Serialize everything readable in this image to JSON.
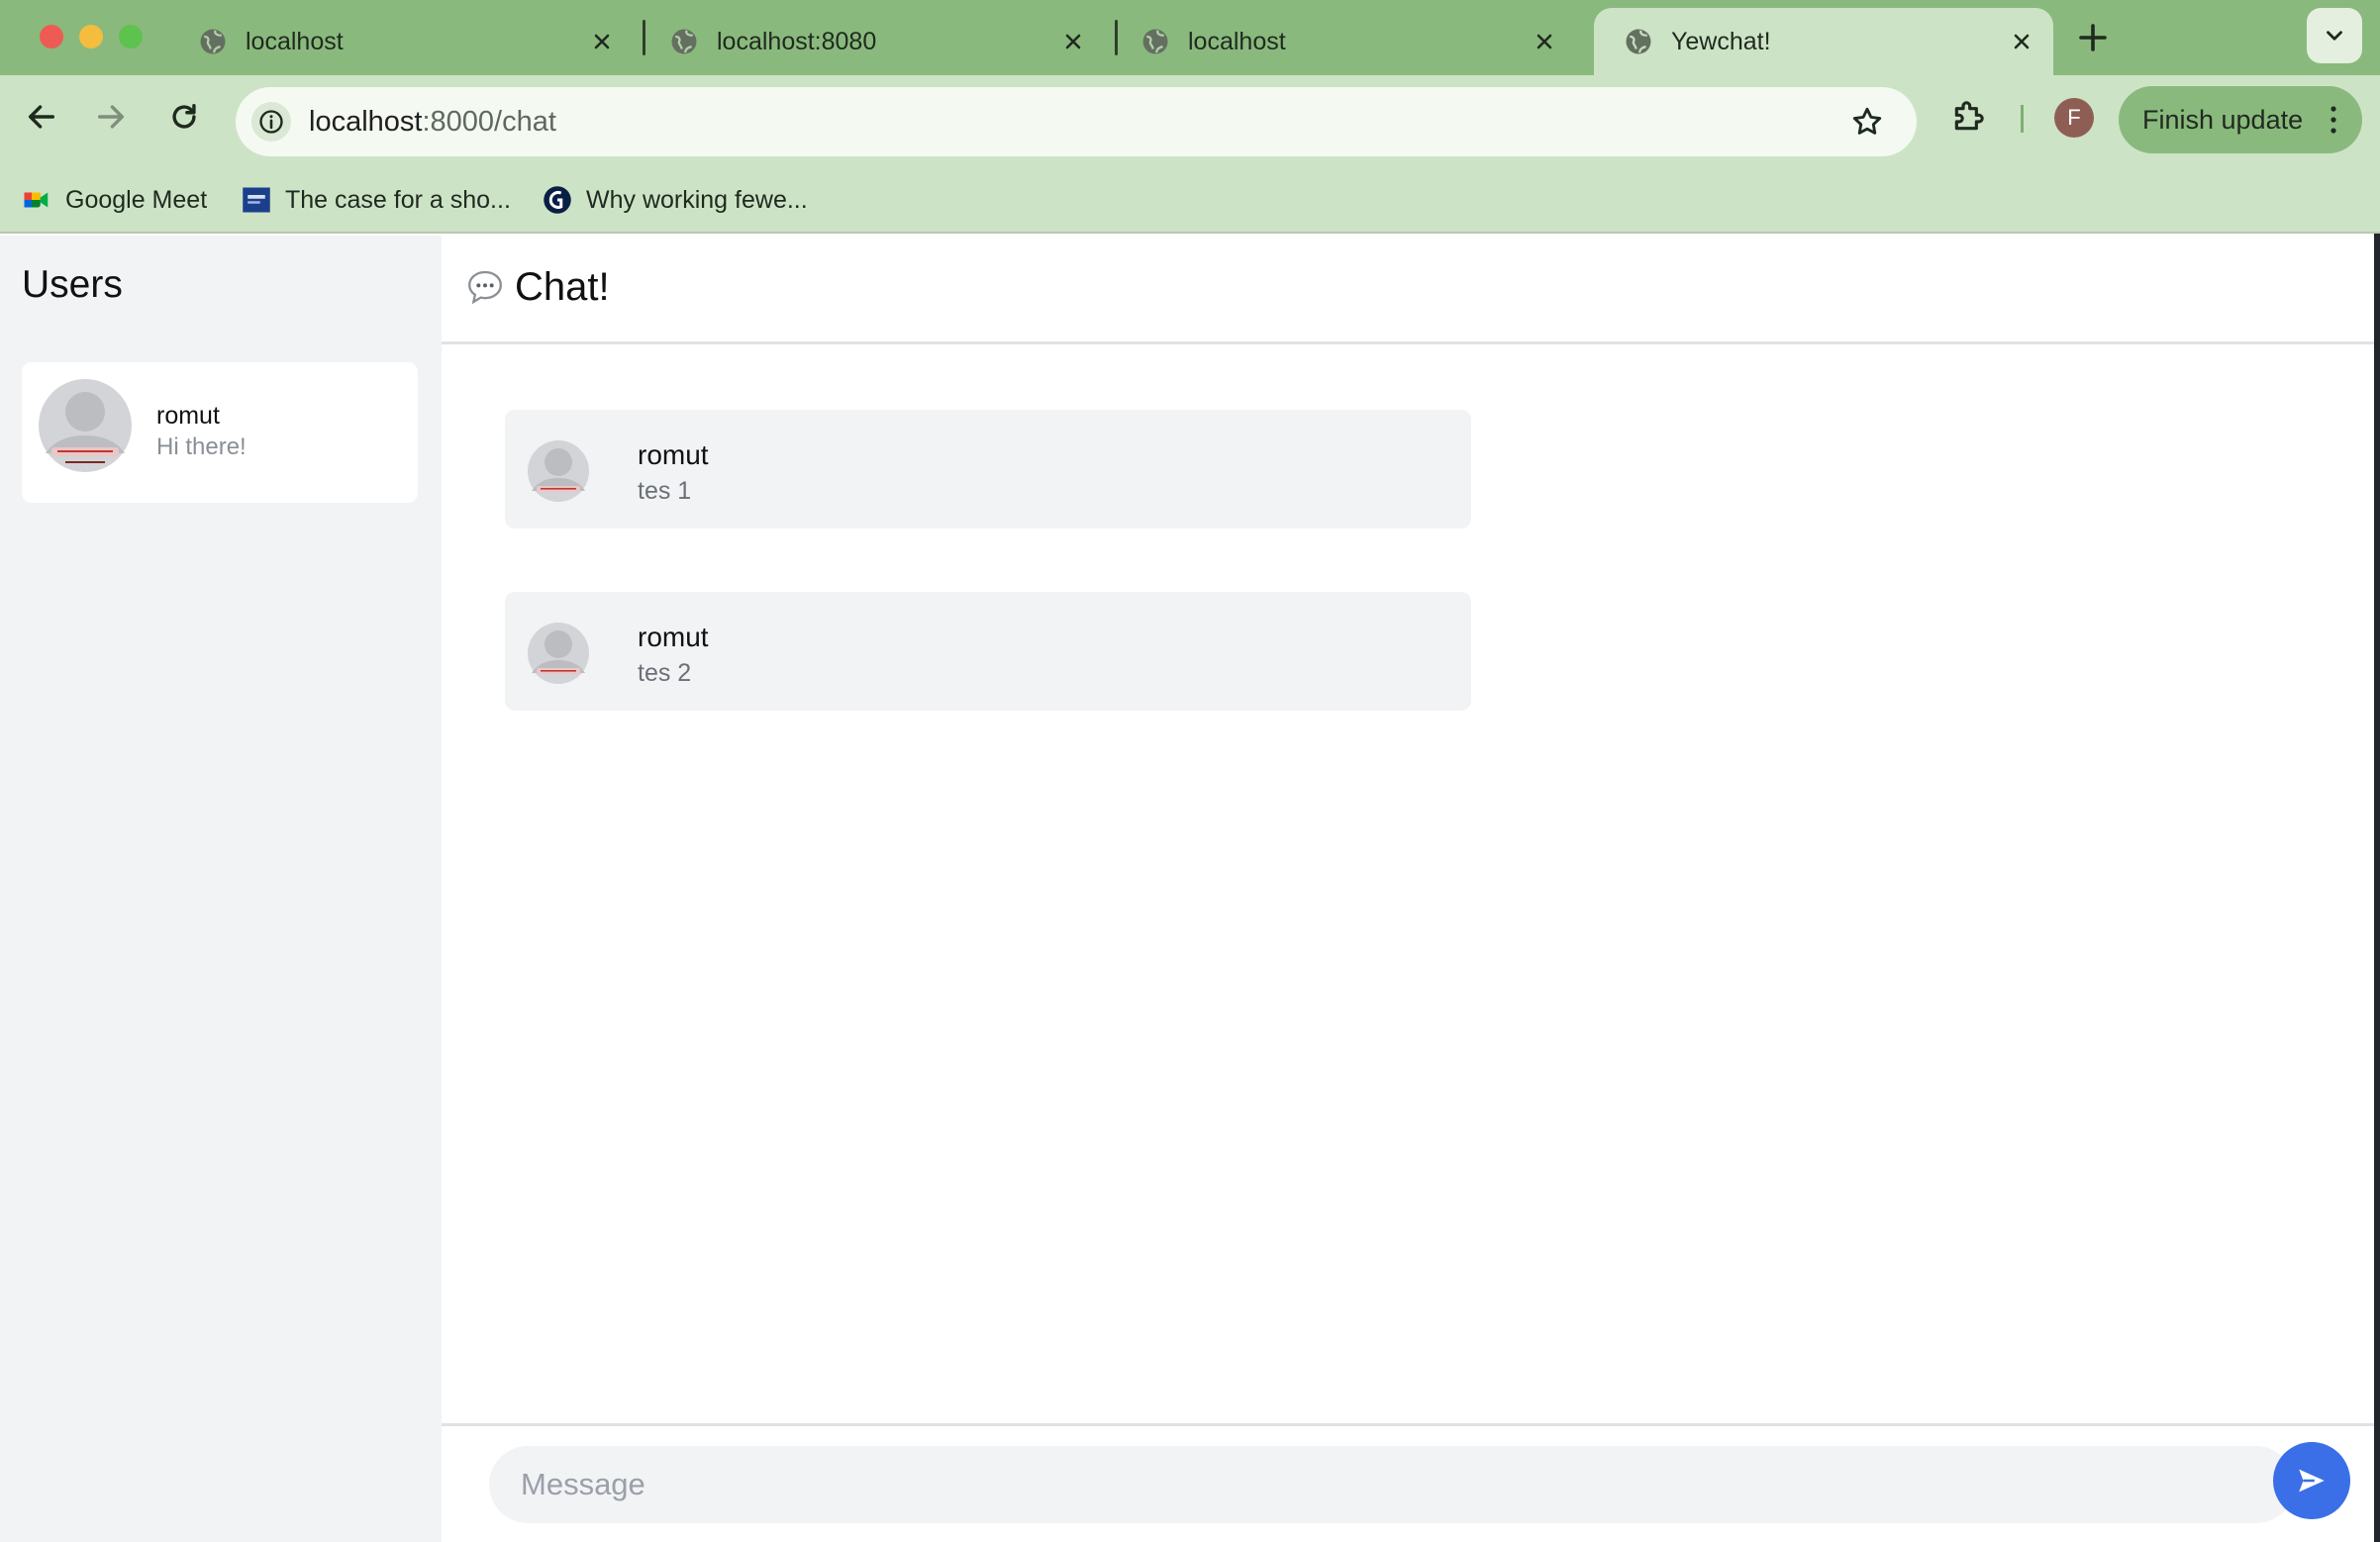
{
  "tabs": [
    {
      "title": "localhost",
      "active": false
    },
    {
      "title": "localhost:8080",
      "active": false
    },
    {
      "title": "localhost",
      "active": false
    },
    {
      "title": "Yewchat!",
      "active": true
    }
  ],
  "toolbar": {
    "url_host": "localhost",
    "url_path": ":8000/chat",
    "profile_initial": "F",
    "finish_update_label": "Finish update"
  },
  "bookmarks": [
    {
      "label": "Google Meet",
      "icon": "google-meet-icon"
    },
    {
      "label": "The case for a sho...",
      "icon": "article-thumbnail-icon"
    },
    {
      "label": "Why working fewe...",
      "icon": "guardian-icon"
    }
  ],
  "sidebar": {
    "title": "Users",
    "users": [
      {
        "name": "romut",
        "last_message": "Hi there!"
      }
    ]
  },
  "chat": {
    "title": "Chat!",
    "messages": [
      {
        "author": "romut",
        "text": "tes 1"
      },
      {
        "author": "romut",
        "text": "tes 2"
      }
    ],
    "input_placeholder": "Message"
  },
  "colors": {
    "tabstrip": "#8ab97d",
    "toolbar": "#cde3c6",
    "sidebar_bg": "#f2f3f5",
    "send_button": "#3b6fe8"
  }
}
